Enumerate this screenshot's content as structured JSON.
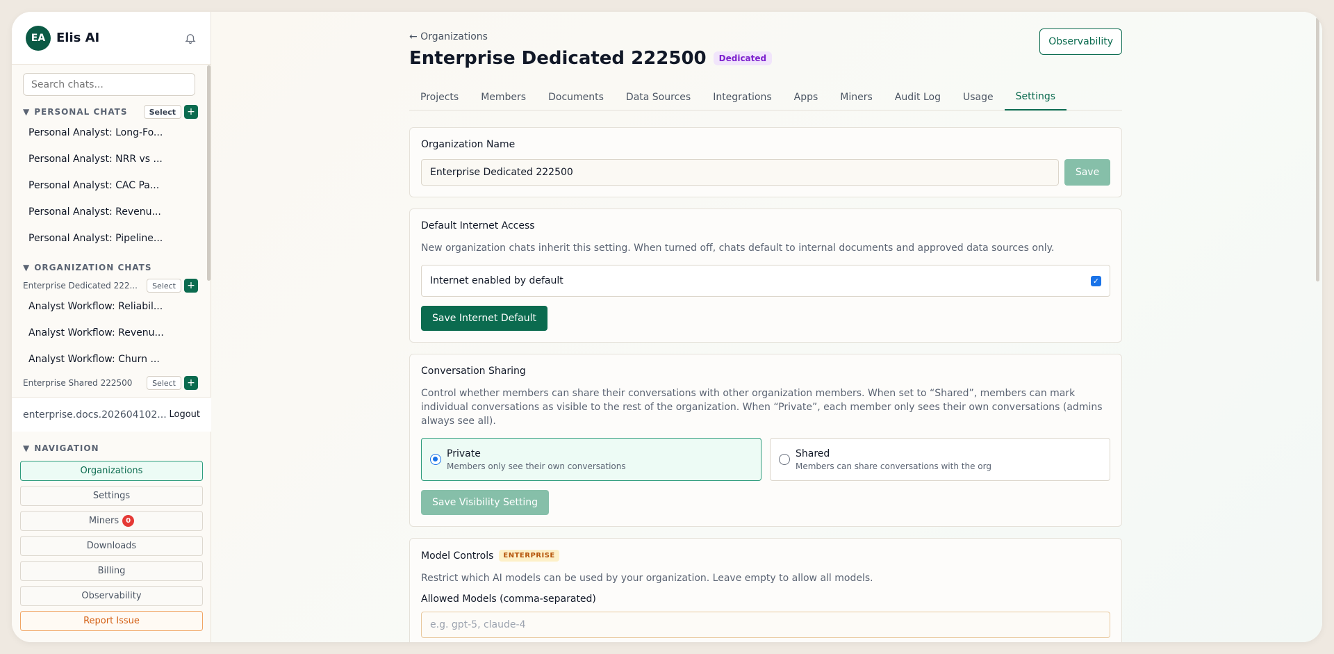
{
  "sidebar": {
    "avatar": "EA",
    "brand": "Elis AI",
    "search_placeholder": "Search chats...",
    "personal_title": "PERSONAL CHATS",
    "select_label": "Select",
    "plus_label": "+",
    "personal_chats": [
      "Personal Analyst: Long-Fo...",
      "Personal Analyst: NRR vs ...",
      "Personal Analyst: CAC Pa...",
      "Personal Analyst: Revenu...",
      "Personal Analyst: Pipeline..."
    ],
    "org_title": "ORGANIZATION CHATS",
    "org1_name": "Enterprise Dedicated 222...",
    "org1_chats": [
      "Analyst Workflow: Reliabil...",
      "Analyst Workflow: Revenu...",
      "Analyst Workflow: Churn ..."
    ],
    "org2_name": "Enterprise Shared 222500",
    "account_email": "enterprise.docs.202604102...",
    "logout": "Logout",
    "nav_title": "NAVIGATION",
    "nav": {
      "organizations": "Organizations",
      "settings": "Settings",
      "miners": "Miners",
      "miners_count": "0",
      "downloads": "Downloads",
      "billing": "Billing",
      "observability": "Observability",
      "report": "Report Issue"
    },
    "triangle": "▼"
  },
  "main": {
    "back": "← Organizations",
    "title": "Enterprise Dedicated 222500",
    "badge": "Dedicated",
    "observability_button": "Observability",
    "tabs": [
      "Projects",
      "Members",
      "Documents",
      "Data Sources",
      "Integrations",
      "Apps",
      "Miners",
      "Audit Log",
      "Usage",
      "Settings"
    ],
    "org_name_card": {
      "title": "Organization Name",
      "value": "Enterprise Dedicated 222500",
      "save": "Save"
    },
    "internet_card": {
      "title": "Default Internet Access",
      "desc": "New organization chats inherit this setting. When turned off, chats default to internal documents and approved data sources only.",
      "checkbox_label": "Internet enabled by default",
      "checked": true,
      "button": "Save Internet Default"
    },
    "sharing_card": {
      "title": "Conversation Sharing",
      "desc": "Control whether members can share their conversations with other organization members. When set to “Shared”, members can mark individual conversations as visible to the rest of the organization. When “Private”, each member only sees their own conversations (admins always see all).",
      "private_label": "Private",
      "private_sub": "Members only see their own conversations",
      "shared_label": "Shared",
      "shared_sub": "Members can share conversations with the org",
      "selected": "Private",
      "button": "Save Visibility Setting"
    },
    "model_card": {
      "title": "Model Controls",
      "badge": "ENTERPRISE",
      "desc": "Restrict which AI models can be used by your organization. Leave empty to allow all models.",
      "field_label": "Allowed Models (comma-separated)",
      "placeholder": "e.g. gpt-5, claude-4"
    }
  },
  "colors": {
    "accent": "#0b6b4f",
    "accent_light": "#86bfa9",
    "badge_purple": "#7e22ce",
    "danger": "#e53935",
    "report_orange": "#d35f13"
  }
}
